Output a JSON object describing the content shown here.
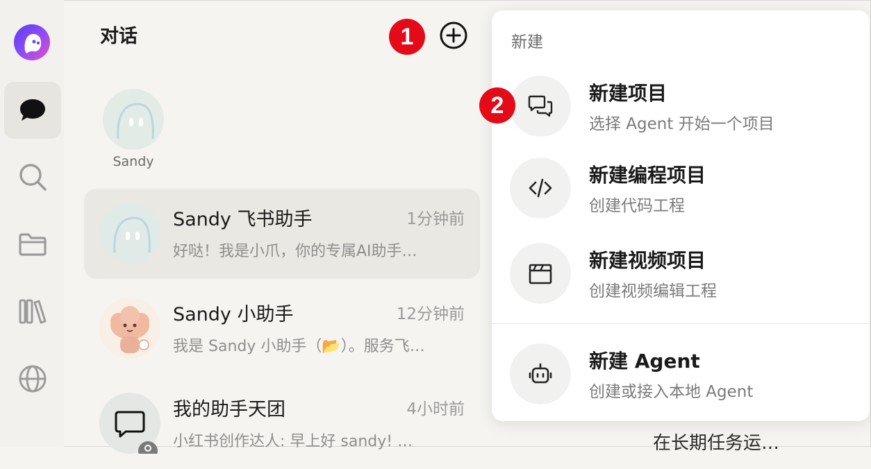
{
  "rail": {
    "items": [
      "chat-icon",
      "search-icon",
      "folder-icon",
      "library-icon",
      "globe-icon"
    ]
  },
  "list": {
    "title": "对话",
    "pinned": {
      "name": "Sandy"
    },
    "conversations": [
      {
        "title": "Sandy 飞书助手",
        "time": "1分钟前",
        "preview": "好哒！我是小爪，你的专属AI助手…"
      },
      {
        "title": "Sandy 小助手",
        "time": "12分钟前",
        "preview": "我是 Sandy 小助手（📂）。服务飞…"
      },
      {
        "title": "我的助手天团",
        "time": "4小时前",
        "preview": "小红书创作达人: 早上好 sandy! …"
      }
    ]
  },
  "markers": {
    "one": "1",
    "two": "2"
  },
  "menu": {
    "section": "新建",
    "items": [
      {
        "label": "新建项目",
        "desc": "选择 Agent 开始一个项目",
        "icon": "chat-bubbles-icon"
      },
      {
        "label": "新建编程项目",
        "desc": "创建代码工程",
        "icon": "code-icon"
      },
      {
        "label": "新建视频项目",
        "desc": "创建视频编辑工程",
        "icon": "clapperboard-icon"
      },
      {
        "label": "新建 Agent",
        "desc": "创建或接入本地 Agent",
        "icon": "robot-icon"
      }
    ]
  },
  "peek": "在长期任务运…"
}
